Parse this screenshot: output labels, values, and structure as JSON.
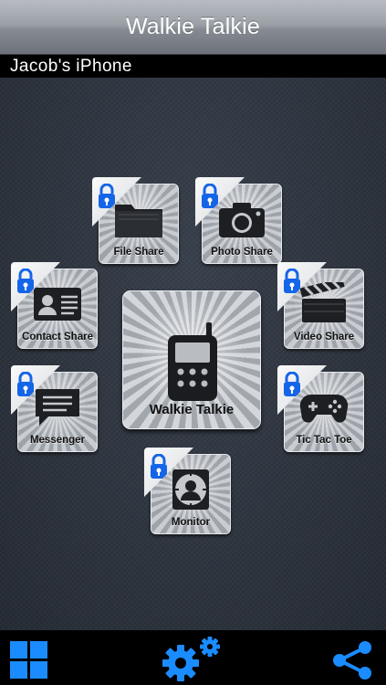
{
  "header": {
    "title": "Walkie Talkie"
  },
  "device": {
    "name": "Jacob's iPhone"
  },
  "features": {
    "file_share": "File Share",
    "photo_share": "Photo Share",
    "contact_share": "Contact Share",
    "video_share": "Video Share",
    "walkie_talkie": "Walkie Talkie",
    "messenger": "Messenger",
    "tic_tac_toe": "Tic Tac Toe",
    "monitor": "Monitor"
  },
  "icons": {
    "lock": "lock-icon",
    "folder": "folder-icon",
    "camera": "camera-icon",
    "contact_card": "contact-card-icon",
    "clapperboard": "clapperboard-icon",
    "walkie": "walkie-talkie-icon",
    "chat": "chat-bubble-icon",
    "gamepad": "gamepad-icon",
    "monitor": "monitor-icon",
    "grid": "grid-icon",
    "settings": "settings-gears-icon",
    "share": "share-icon"
  },
  "colors": {
    "accent_blue": "#1a8cff",
    "lock_blue": "#1565e8",
    "toolbar_bg": "#000000"
  }
}
